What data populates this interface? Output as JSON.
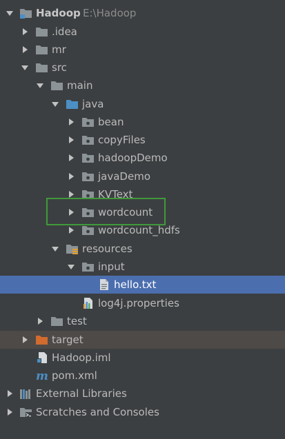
{
  "tree": {
    "root": {
      "label": "Hadoop",
      "path": "E:\\Hadoop",
      "icon": "module-folder-icon"
    },
    "idea": {
      "label": ".idea",
      "icon": "folder-icon"
    },
    "mr": {
      "label": "mr",
      "icon": "folder-icon"
    },
    "src": {
      "label": "src",
      "icon": "folder-icon"
    },
    "main": {
      "label": "main",
      "icon": "folder-icon"
    },
    "java": {
      "label": "java",
      "icon": "source-root-folder-icon"
    },
    "bean": {
      "label": "bean",
      "icon": "package-icon"
    },
    "copyFiles": {
      "label": "copyFiles",
      "icon": "package-icon"
    },
    "hadoopDemo": {
      "label": "hadoopDemo",
      "icon": "package-icon"
    },
    "javaDemo": {
      "label": "javaDemo",
      "icon": "package-icon"
    },
    "kvtext": {
      "label": "KVText",
      "icon": "package-icon"
    },
    "wordcount": {
      "label": "wordcount",
      "icon": "package-icon"
    },
    "wordcount_hdfs": {
      "label": "wordcount_hdfs",
      "icon": "package-icon"
    },
    "resources": {
      "label": "resources",
      "icon": "resources-folder-icon"
    },
    "input": {
      "label": "input",
      "icon": "package-icon"
    },
    "hello": {
      "label": "hello.txt",
      "icon": "text-file-icon"
    },
    "log4j": {
      "label": "log4j.properties",
      "icon": "properties-file-icon"
    },
    "test": {
      "label": "test",
      "icon": "folder-icon"
    },
    "target": {
      "label": "target",
      "icon": "excluded-folder-icon"
    },
    "iml": {
      "label": "Hadoop.iml",
      "icon": "iml-file-icon"
    },
    "pom": {
      "label": "pom.xml",
      "icon": "maven-icon"
    },
    "extlib": {
      "label": "External Libraries",
      "icon": "libraries-icon"
    },
    "scratches": {
      "label": "Scratches and Consoles",
      "icon": "scratches-icon"
    }
  },
  "colors": {
    "background": "#3c3f41",
    "selection": "#4b6eaf",
    "text": "#bbbbbb",
    "folder": "#8c9397",
    "source_folder": "#4b8fc5",
    "excluded_folder": "#d16b2e",
    "highlight_box": "#3f9a3a"
  }
}
